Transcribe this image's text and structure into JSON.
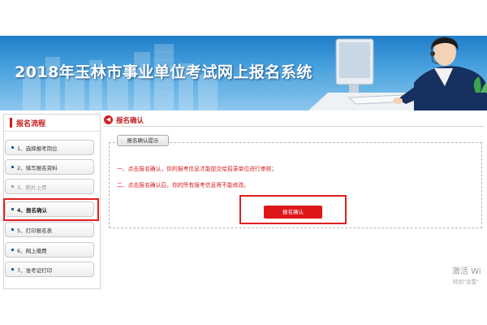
{
  "header": {
    "title": "2018年玉林市事业单位考试网上报名系统"
  },
  "sidebar": {
    "title": "报名流程",
    "items": [
      {
        "label": "1、选择报考岗位",
        "state": "normal"
      },
      {
        "label": "2、填写报名资料",
        "state": "normal"
      },
      {
        "label": "3、照片上传",
        "state": "done"
      },
      {
        "label": "4、报名确认",
        "state": "active"
      },
      {
        "label": "5、打印报名表",
        "state": "normal"
      },
      {
        "label": "6、网上缴费",
        "state": "normal"
      },
      {
        "label": "7、准考证打印",
        "state": "normal"
      }
    ]
  },
  "main": {
    "title": "报名确认",
    "notice": {
      "tab_label": "报名确认提示",
      "lines": [
        "一、点击报名确认，你的报考信息才能提交给招录单位进行审核；",
        "二、点击报名确认后，你的所有报考信息将不能修改。"
      ]
    },
    "confirm_button": "报名确认"
  },
  "watermark": {
    "line1": "激活 Wi",
    "line2": "转到\"设置\""
  },
  "colors": {
    "accent_red": "#dd1717",
    "banner_blue": "#1f7ec9",
    "step_dot_blue": "#1f5fa8"
  },
  "icons": {
    "main_title": "red-circle-arrow-icon",
    "step_marker": "square-bullet-icon"
  }
}
